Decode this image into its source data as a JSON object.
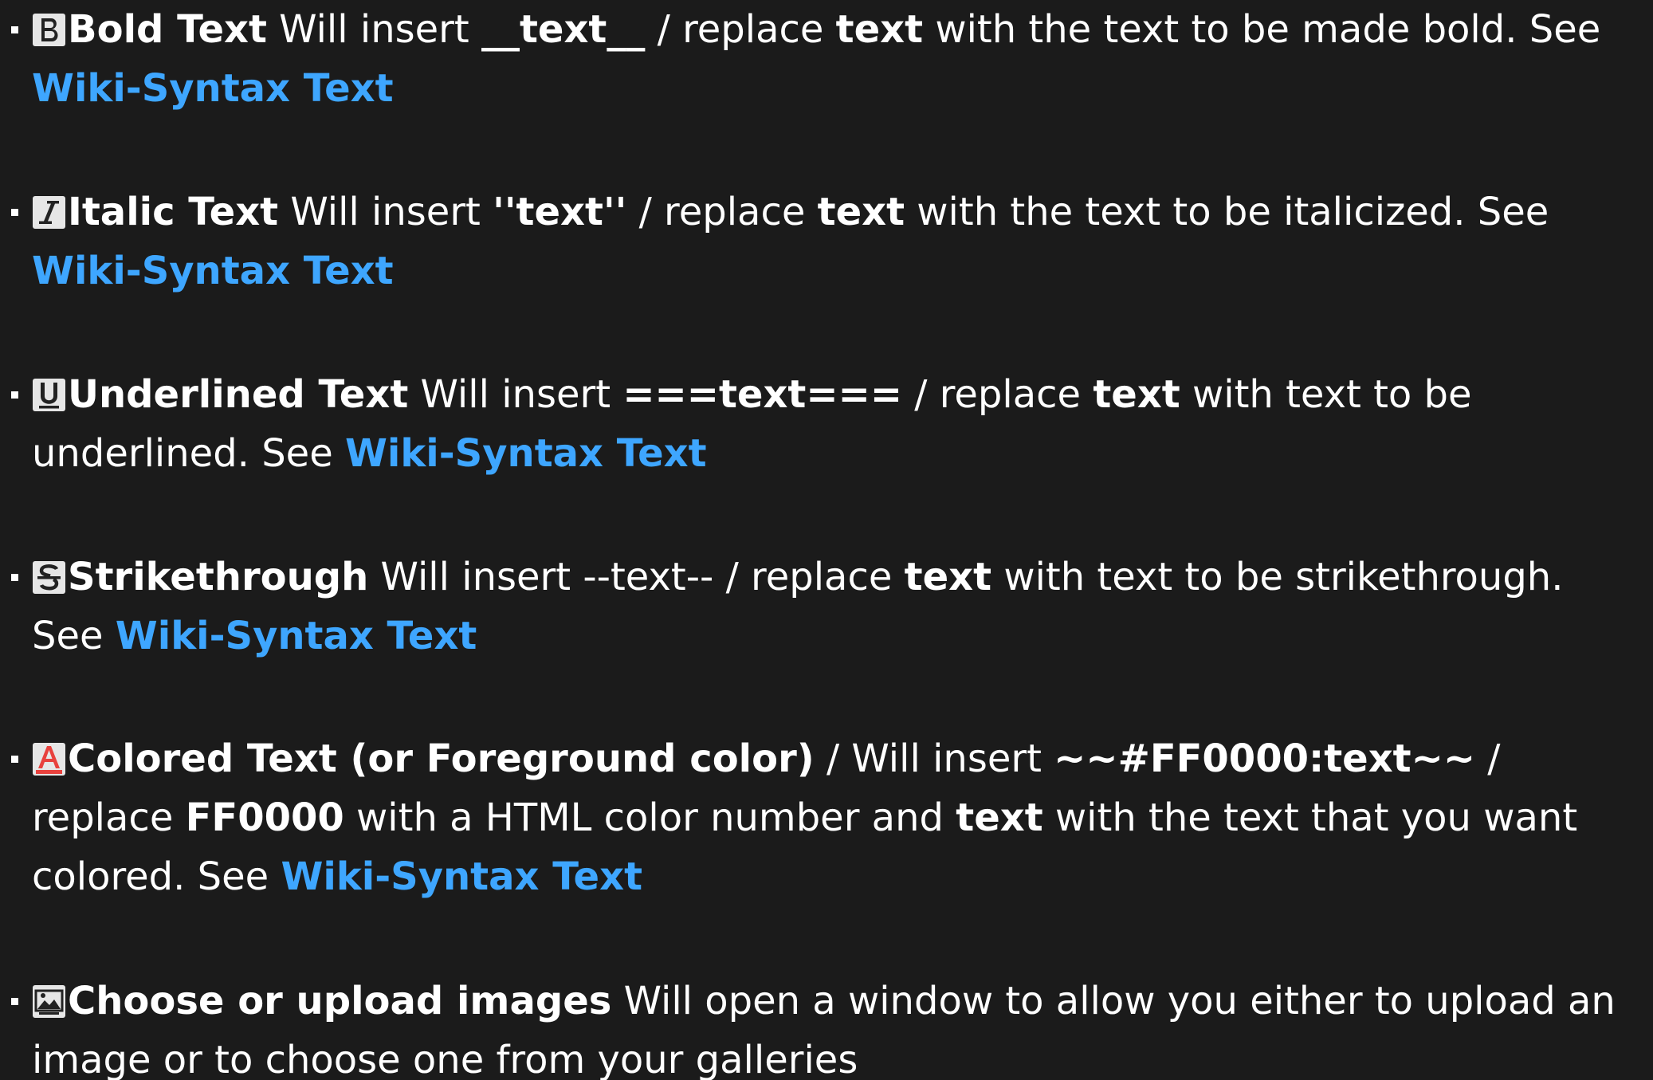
{
  "items": [
    {
      "icon": "bold-icon",
      "title": "Bold Text",
      "t1": " Will insert ",
      "code": "__text__",
      "t2": " / replace ",
      "word": "text",
      "t3": " with the text to be made bold. See ",
      "link": "Wiki-Syntax Text"
    },
    {
      "icon": "italic-icon",
      "title": "Italic Text",
      "t1": " Will insert ",
      "code": "''text''",
      "t2": " / replace ",
      "word": "text",
      "t3": " with the text to be italicized. See ",
      "link": "Wiki-Syntax Text"
    },
    {
      "icon": "underline-icon",
      "title": "Underlined Text",
      "t1": " Will insert ",
      "code": "===text===",
      "t2": " / replace ",
      "word": "text",
      "t3": " with text to be underlined. See ",
      "link": "Wiki-Syntax Text"
    },
    {
      "icon": "strikethrough-icon",
      "title": "Strikethrough",
      "t1": " Will insert --text-- / replace ",
      "word": "text",
      "t3": " with text to be strikethrough. See ",
      "link": "Wiki-Syntax Text"
    },
    {
      "icon": "text-color-icon",
      "title": "Colored Text (or Foreground color)",
      "t1": " / Will insert ",
      "code": "~~#FF0000:text~~",
      "t2": " / replace ",
      "color_code": "FF0000",
      "t4": " with a HTML color number and ",
      "word": "text",
      "t3": " with the text that you want colored. See ",
      "link": "Wiki-Syntax Text",
      "accent": "#e8413d"
    },
    {
      "icon": "image-icon",
      "title": "Choose or upload images",
      "t1": " Will open a window to allow you either to upload an image or to choose one from your galleries"
    }
  ],
  "colors": {
    "background": "#1b1b1b",
    "text": "#ffffff",
    "link": "#3ea6ff"
  }
}
